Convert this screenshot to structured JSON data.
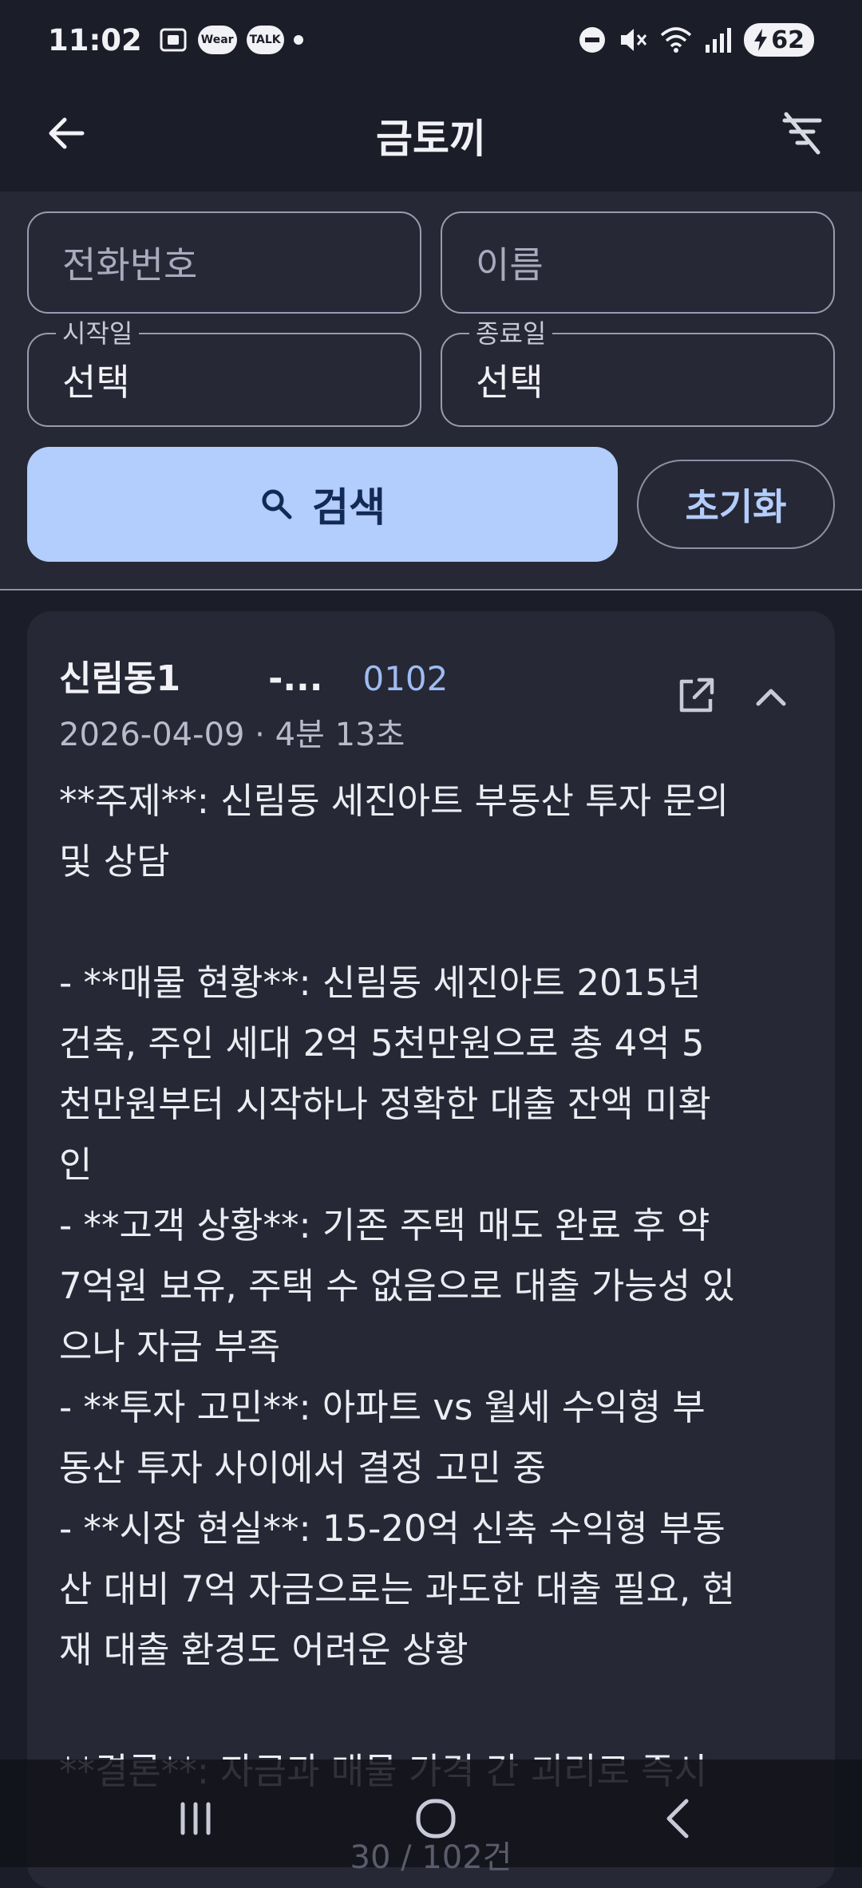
{
  "status_bar": {
    "time": "11:02",
    "icons": [
      "screen-capture-icon",
      "wear-icon",
      "kakao-talk-icon",
      "notification-dot"
    ],
    "wear_label": "Wear",
    "talk_label": "TALK",
    "right_icons": [
      "do-not-disturb-icon",
      "mute-icon",
      "wifi-icon",
      "signal-icon"
    ],
    "battery": "62"
  },
  "app_bar": {
    "title": "금토끼",
    "back_icon": "arrow-back-icon",
    "filter_icon": "filter-off-icon"
  },
  "filters": {
    "phone_placeholder": "전화번호",
    "name_placeholder": "이름",
    "start_label": "시작일",
    "start_value": "선택",
    "end_label": "종료일",
    "end_value": "선택",
    "search_label": "검색",
    "reset_label": "초기화"
  },
  "card": {
    "name": "신림동1",
    "ellipsis": "-...",
    "number": "0102",
    "meta": "2026-04-09 · 4분 13초",
    "body": "**주제**: 신림동 세진아트 부동산 투자 문의\n및 상담\n\n- **매물 현황**: 신림동 세진아트 2015년\n건축, 주인 세대 2억 5천만원으로 총 4억 5\n천만원부터 시작하나 정확한 대출 잔액 미확\n인\n- **고객 상황**: 기존 주택 매도 완료 후 약\n7억원 보유, 주택 수 없음으로 대출 가능성 있\n으나 자금 부족\n- **투자 고민**: 아파트 vs 월세 수익형 부\n동산 투자 사이에서 결정 고민 중\n- **시장 현실**: 15-20억 신축 수익형 부동\n산 대비 7억 자금으로는 과도한 대출 필요, 현\n재 대출 환경도 어려운 상황\n\n**결론**: 자금과 매물 가격 간 괴리로 즉시"
  },
  "footer": {
    "count": "30 / 102건"
  },
  "colors": {
    "background": "#1b1d28",
    "panel": "#262835",
    "accent": "#b3cdfc",
    "number": "#9fbcf2"
  }
}
